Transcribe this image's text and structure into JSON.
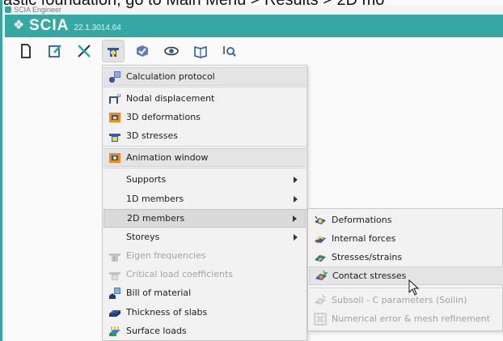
{
  "caption": "astic foundation, go to Main Menu > Results > 2D mo",
  "app": {
    "window_title": "SCIA Engineer",
    "brand": "SCIA",
    "version": "22.1.3014.64"
  },
  "toolbar": {
    "buttons": [
      {
        "icon": "new-file-icon"
      },
      {
        "icon": "edit-icon"
      },
      {
        "icon": "tools-icon"
      },
      {
        "icon": "results-icon",
        "active": true
      },
      {
        "icon": "check-icon"
      },
      {
        "icon": "view-icon"
      },
      {
        "icon": "book-icon"
      },
      {
        "icon": "search-results-icon"
      }
    ]
  },
  "menu": {
    "items": [
      {
        "label": "Calculation protocol",
        "icon": "calculation-protocol-icon"
      },
      {
        "label": "Nodal displacement",
        "icon": "nodal-displacement-icon"
      },
      {
        "label": "3D deformations",
        "icon": "3d-deformations-icon"
      },
      {
        "label": "3D stresses",
        "icon": "3d-stresses-icon"
      },
      {
        "label": "Animation window",
        "icon": "animation-window-icon"
      },
      {
        "label": "Supports",
        "submenu": true
      },
      {
        "label": "1D members",
        "submenu": true
      },
      {
        "label": "2D members",
        "submenu": true,
        "selected": true
      },
      {
        "label": "Storeys",
        "submenu": true
      },
      {
        "label": "Eigen frequencies",
        "icon": "eigen-frequencies-icon",
        "disabled": true
      },
      {
        "label": "Critical load coefficients",
        "icon": "critical-load-icon",
        "disabled": true
      },
      {
        "label": "Bill of material",
        "icon": "bill-of-material-icon"
      },
      {
        "label": "Thickness of slabs",
        "icon": "thickness-of-slabs-icon"
      },
      {
        "label": "Surface loads",
        "icon": "surface-loads-icon"
      }
    ]
  },
  "submenu": {
    "items": [
      {
        "label": "Deformations",
        "icon": "deformations-icon"
      },
      {
        "label": "Internal forces",
        "icon": "internal-forces-icon"
      },
      {
        "label": "Stresses/strains",
        "icon": "stresses-strains-icon"
      },
      {
        "label": "Contact stresses",
        "icon": "contact-stresses-icon",
        "hover": true
      },
      {
        "label": "Subsoil - C parameters (Soilin)",
        "icon": "subsoil-icon",
        "disabled": true
      },
      {
        "label": "Numerical error & mesh refinement",
        "icon": "numerical-error-icon",
        "disabled": true
      }
    ]
  },
  "colors": {
    "brand_teal": "#35a8a3",
    "menu_bg": "#f2f2f2",
    "disabled_text": "#a3a3a3"
  }
}
